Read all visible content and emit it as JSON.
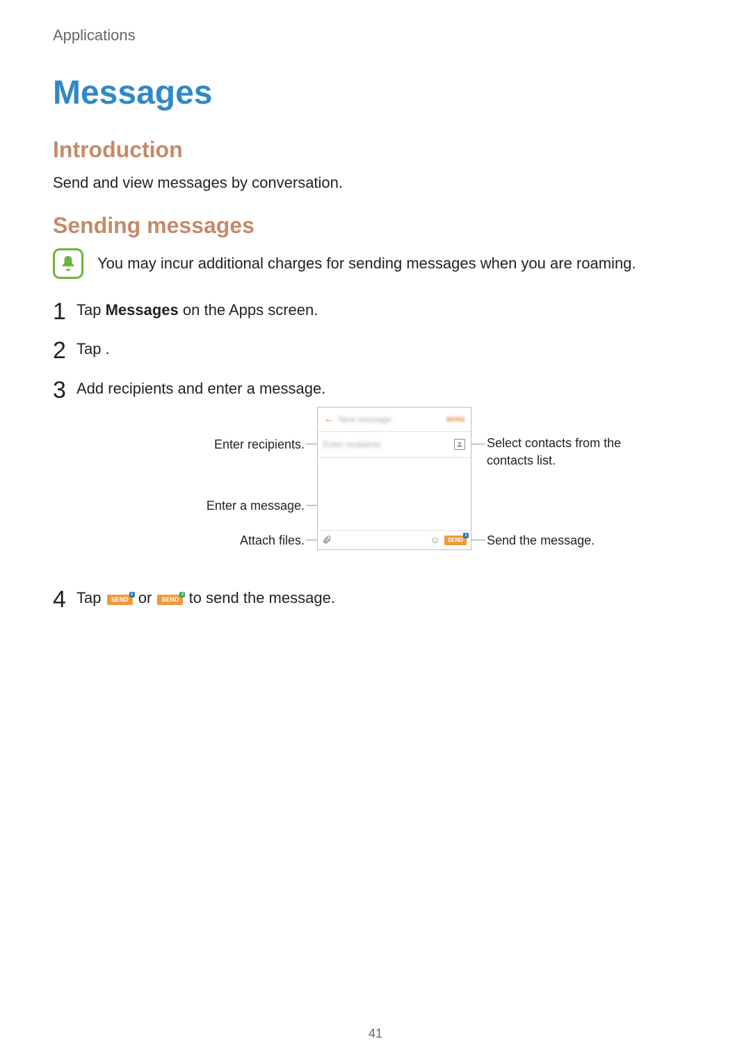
{
  "header": {
    "section": "Applications"
  },
  "title": "Messages",
  "intro": {
    "heading": "Introduction",
    "text": "Send and view messages by conversation."
  },
  "sending": {
    "heading": "Sending messages",
    "note": "You may incur additional charges for sending messages when you are roaming.",
    "steps": {
      "s1_pre": "Tap ",
      "s1_bold": "Messages",
      "s1_post": " on the Apps screen.",
      "s2_pre": "Tap ",
      "s2_post": " .",
      "s3": "Add recipients and enter a message.",
      "s4_pre": "Tap ",
      "s4_mid": " or ",
      "s4_post": " to send the message."
    },
    "callouts": {
      "recip": "Enter recipients.",
      "contacts_l1": "Select contacts from the ",
      "contacts_l2": "contacts list.",
      "msg": "Enter a message.",
      "attach": "Attach files.",
      "send": "Send the message."
    },
    "send_label": "SEND"
  },
  "page_number": "41"
}
